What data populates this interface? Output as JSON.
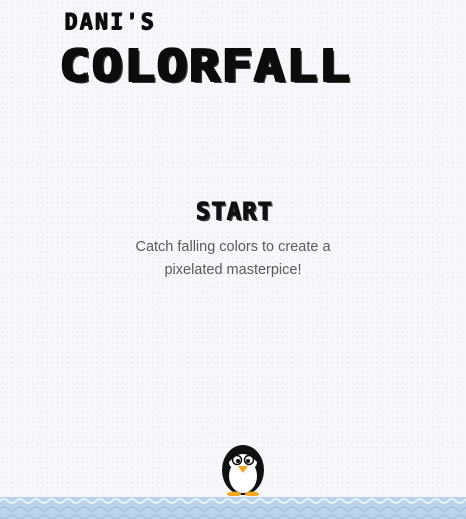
{
  "title": {
    "subtitle": "Dani's",
    "main": "Colorfall"
  },
  "start": {
    "label": "START"
  },
  "tagline": {
    "line1": "Catch falling colors to create a",
    "line2": "pixelated masterpice!"
  },
  "colors": {
    "background": "#f5f7fa",
    "title": "#0c0c0c",
    "text": "#5a5a5a",
    "water": "#b9d3ea",
    "penguin_body": "#111111",
    "penguin_belly": "#ffffff",
    "penguin_beak": "#f5a623"
  }
}
